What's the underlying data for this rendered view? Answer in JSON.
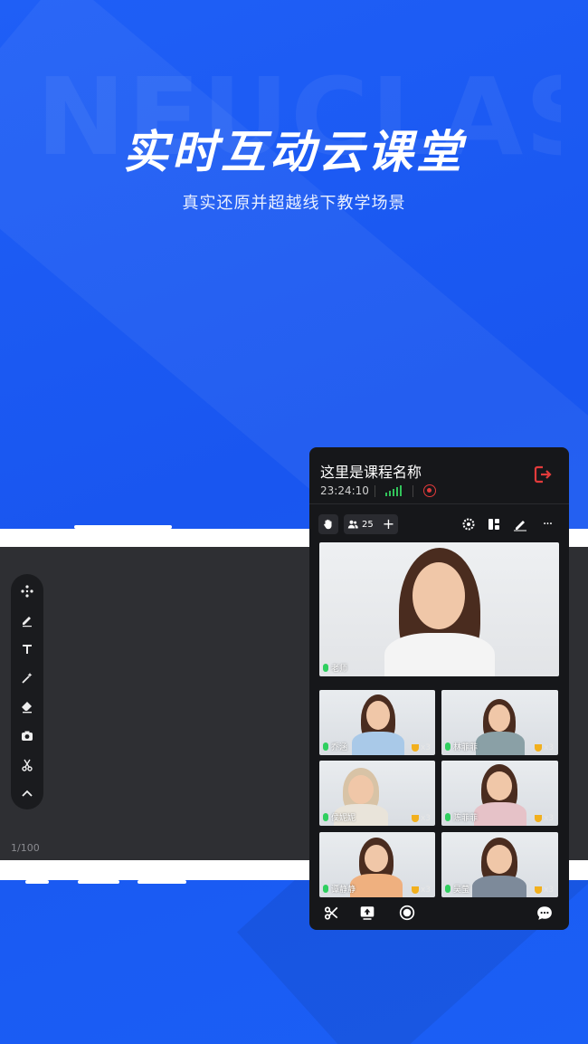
{
  "promo": {
    "watermark": "NEUCLASS",
    "headline": "实时互动云课堂",
    "subheadline": "真实还原并超越线下教学场景"
  },
  "whiteboard": {
    "page_indicator": "1/100",
    "tools": [
      {
        "icon": "move-icon"
      },
      {
        "icon": "pen-icon"
      },
      {
        "icon": "text-icon"
      },
      {
        "icon": "magic-wand-icon"
      },
      {
        "icon": "eraser-icon"
      },
      {
        "icon": "camera-icon"
      },
      {
        "icon": "scissors-icon"
      },
      {
        "icon": "chevron-up-icon"
      }
    ]
  },
  "classroom": {
    "course_name": "这里是课程名称",
    "elapsed_time": "23:24:10",
    "participants_count": "25",
    "teacher": {
      "name": "老师"
    },
    "students": [
      {
        "name": "乔涵",
        "awards": "x3"
      },
      {
        "name": "林菲菲",
        "awards": "x3"
      },
      {
        "name": "侯妮妮",
        "awards": "x3"
      },
      {
        "name": "陈菲菲",
        "awards": "x3"
      },
      {
        "name": "谭静静",
        "awards": "x3"
      },
      {
        "name": "吴莹",
        "awards": "x3"
      }
    ],
    "more_label": "···",
    "colors": {
      "accent": "#1b5ff5",
      "panel_bg": "#16171a",
      "record": "#e23b3b",
      "mic_on": "#2fcf5f",
      "signal": "#32c35a"
    }
  }
}
